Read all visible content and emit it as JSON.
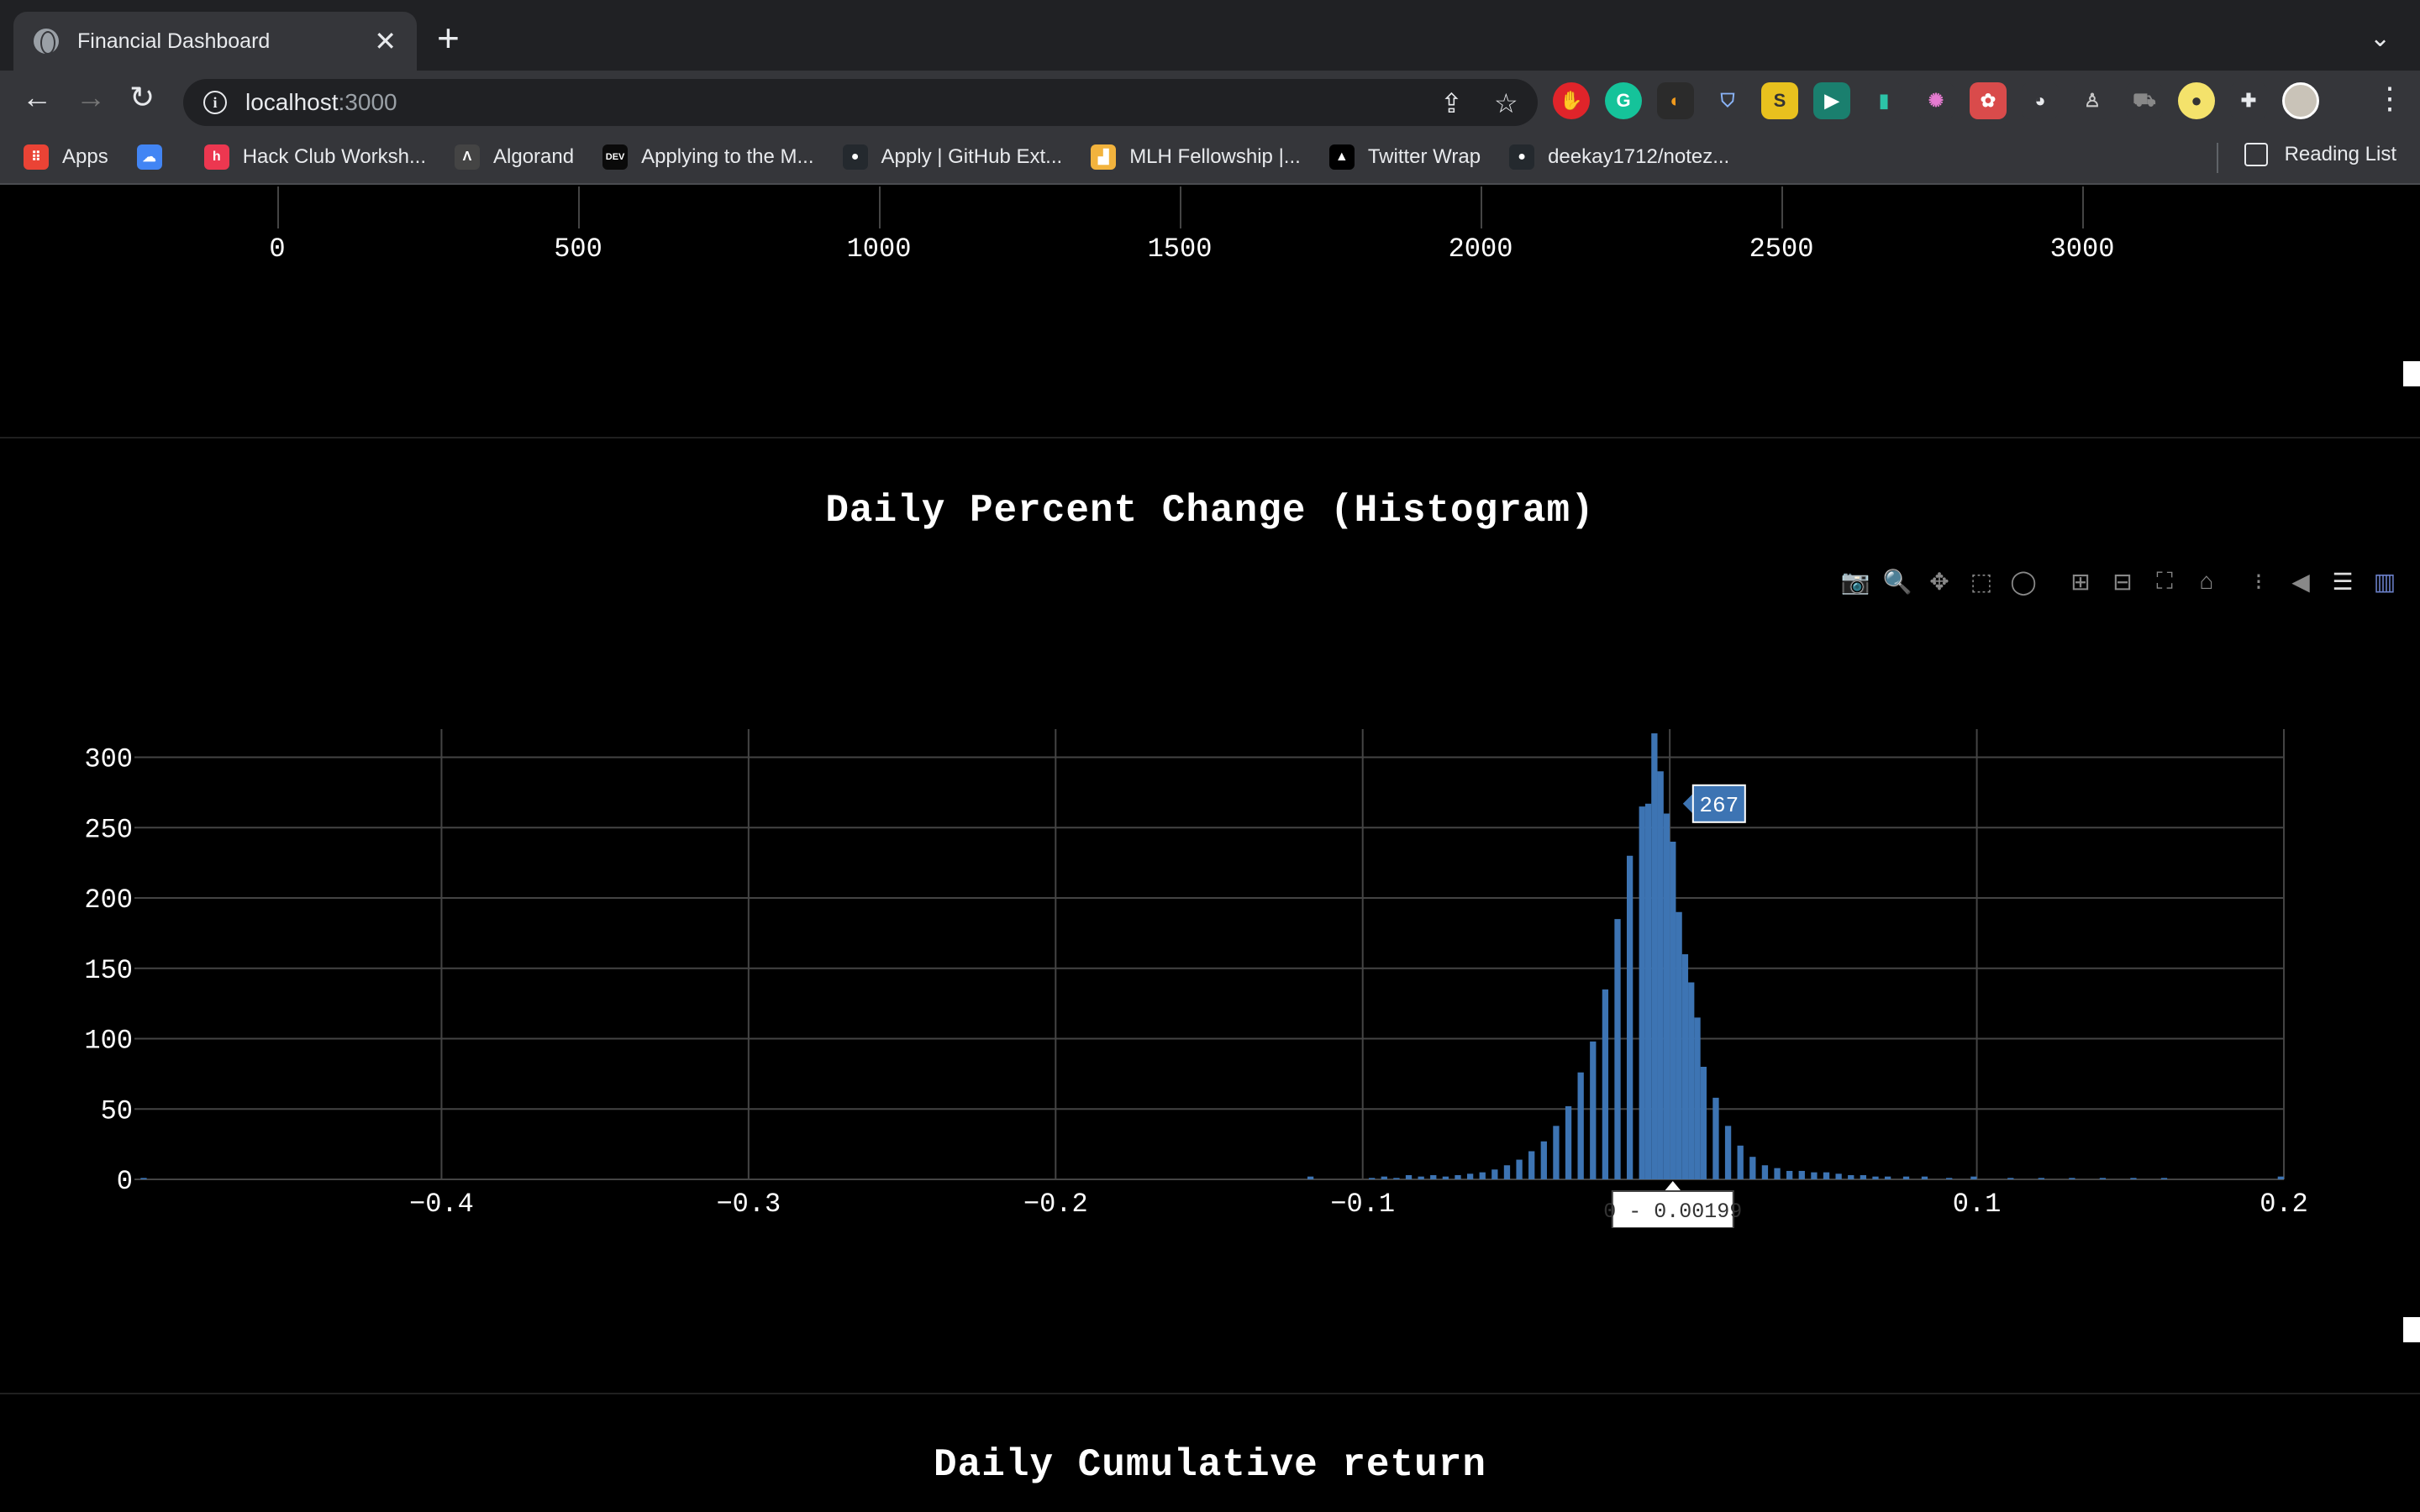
{
  "browser": {
    "tab_title": "Financial Dashboard",
    "tab_close": "✕",
    "new_tab": "+",
    "url_host": "localhost",
    "url_port": ":3000",
    "bookmarks": [
      {
        "label": "Apps",
        "icon": "apps-grid-icon",
        "color": "#ea4335"
      },
      {
        "label": "",
        "icon": "google-cloud-icon",
        "color": "#4285f4"
      },
      {
        "label": "Hack Club Worksh...",
        "icon": "hackclub-icon",
        "color": "#ec3750"
      },
      {
        "label": "Algorand",
        "icon": "algorand-icon",
        "color": "#444444"
      },
      {
        "label": "Applying to the M...",
        "icon": "dev-icon",
        "color": "#0a0a0a"
      },
      {
        "label": "Apply | GitHub Ext...",
        "icon": "github-icon",
        "color": "#24292e"
      },
      {
        "label": "MLH Fellowship |...",
        "icon": "mlh-icon",
        "color": "#f2b33d"
      },
      {
        "label": "Twitter Wrap",
        "icon": "twitter-wrap-icon",
        "color": "#000000"
      },
      {
        "label": "deekay1712/notez...",
        "icon": "github-icon",
        "color": "#24292e"
      }
    ],
    "reading_list": "Reading List"
  },
  "prev_chart": {
    "x_ticks": [
      "0",
      "500",
      "1000",
      "1500",
      "2000",
      "2500",
      "3000"
    ]
  },
  "histogram_title": "Daily Percent Change (Histogram)",
  "next_chart_title": "Daily Cumulative return",
  "colors": {
    "bar": "#3d74b3",
    "grid": "#444444",
    "hover_bg": "#3d74b3"
  },
  "chart_data": {
    "type": "bar",
    "title": "Daily Percent Change (Histogram)",
    "xlabel": "",
    "ylabel": "",
    "xlim": [
      -0.5,
      0.2
    ],
    "ylim": [
      0,
      320
    ],
    "x_ticks": [
      "−0.4",
      "−0.3",
      "−0.2",
      "−0.1",
      "0",
      "0.1",
      "0.2"
    ],
    "x_tick_values": [
      -0.4,
      -0.3,
      -0.2,
      -0.1,
      0,
      0.1,
      0.2
    ],
    "y_ticks": [
      "0",
      "50",
      "100",
      "150",
      "200",
      "250",
      "300"
    ],
    "y_tick_values": [
      0,
      50,
      100,
      150,
      200,
      250,
      300
    ],
    "bin_width": 0.002,
    "bins_x": [
      -0.498,
      -0.118,
      -0.098,
      -0.094,
      -0.09,
      -0.086,
      -0.082,
      -0.078,
      -0.074,
      -0.07,
      -0.066,
      -0.062,
      -0.058,
      -0.054,
      -0.05,
      -0.046,
      -0.042,
      -0.038,
      -0.034,
      -0.03,
      -0.026,
      -0.022,
      -0.018,
      -0.014,
      -0.01,
      -0.008,
      -0.006,
      -0.004,
      -0.002,
      0.0,
      0.002,
      0.004,
      0.006,
      0.008,
      0.01,
      0.014,
      0.018,
      0.022,
      0.026,
      0.03,
      0.034,
      0.038,
      0.042,
      0.046,
      0.05,
      0.054,
      0.058,
      0.062,
      0.066,
      0.07,
      0.076,
      0.082,
      0.09,
      0.098,
      0.11,
      0.12,
      0.13,
      0.14,
      0.15,
      0.16,
      0.198
    ],
    "bins_y": [
      1,
      2,
      1,
      2,
      1,
      3,
      2,
      3,
      2,
      3,
      4,
      5,
      7,
      10,
      14,
      20,
      27,
      38,
      52,
      76,
      98,
      135,
      185,
      230,
      265,
      267,
      317,
      290,
      260,
      240,
      190,
      160,
      140,
      115,
      80,
      58,
      38,
      24,
      16,
      10,
      8,
      6,
      6,
      5,
      5,
      4,
      3,
      3,
      2,
      2,
      2,
      2,
      1,
      2,
      1,
      1,
      1,
      1,
      1,
      1,
      2
    ],
    "hover_value": "267",
    "hover_x_range": "0 - 0.00199"
  }
}
